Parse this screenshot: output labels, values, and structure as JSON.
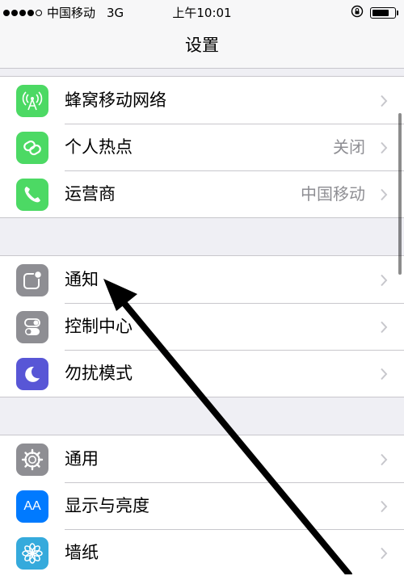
{
  "status_bar": {
    "carrier": "中国移动",
    "network": "3G",
    "time": "上午10:01",
    "battery_level": 0.8
  },
  "nav": {
    "title": "设置"
  },
  "sections": [
    {
      "items": [
        {
          "label": "蜂窝移动网络",
          "value": "",
          "icon": "cellular-antenna-icon",
          "icon_color": "#4cd964"
        },
        {
          "label": "个人热点",
          "value": "关闭",
          "icon": "hotspot-chain-icon",
          "icon_color": "#4cd964"
        },
        {
          "label": "运营商",
          "value": "中国移动",
          "icon": "phone-icon",
          "icon_color": "#4cd964"
        }
      ]
    },
    {
      "items": [
        {
          "label": "通知",
          "value": "",
          "icon": "notifications-icon",
          "icon_color": "#8e8e93"
        },
        {
          "label": "控制中心",
          "value": "",
          "icon": "control-center-icon",
          "icon_color": "#8e8e93"
        },
        {
          "label": "勿扰模式",
          "value": "",
          "icon": "moon-icon",
          "icon_color": "#5856d6"
        }
      ]
    },
    {
      "items": [
        {
          "label": "通用",
          "value": "",
          "icon": "gear-icon",
          "icon_color": "#8e8e93"
        },
        {
          "label": "显示与亮度",
          "value": "",
          "icon": "display-brightness-icon",
          "icon_color": "#007aff",
          "icon_text": "AA"
        },
        {
          "label": "墙纸",
          "value": "",
          "icon": "wallpaper-flower-icon",
          "icon_color": "#35aadc"
        }
      ]
    }
  ]
}
